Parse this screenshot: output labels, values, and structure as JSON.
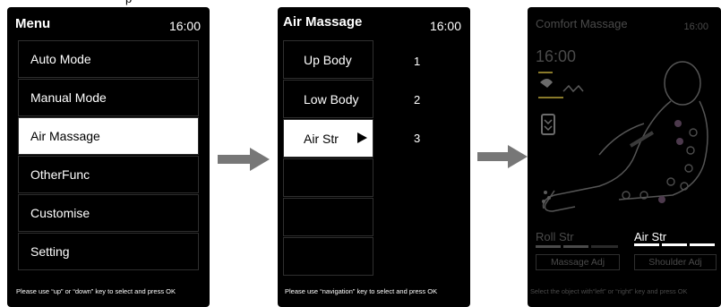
{
  "top_partial_text": "p",
  "screen1": {
    "title": "Menu",
    "time": "16:00",
    "items": [
      "Auto Mode",
      "Manual Mode",
      "Air Massage",
      "OtherFunc",
      "Customise",
      "Setting"
    ],
    "selected_index": 2,
    "footer": "Please use “up” or “down” key to select and press OK"
  },
  "screen2": {
    "title": "Air Massage",
    "time": "16:00",
    "items": [
      "Up Body",
      "Low Body",
      "Air Str",
      "",
      "",
      ""
    ],
    "numbers": [
      "1",
      "2",
      "3"
    ],
    "selected_index": 2,
    "footer": "Please use “navigation” key to select and press OK"
  },
  "screen3": {
    "title": "Comfort Massage",
    "time_corner": "16:00",
    "time_big": "16:00",
    "roll_label": "Roll Str",
    "air_label": "Air Str",
    "massage_adj": "Massage Adj",
    "shoulder_adj": "Shoulder Adj",
    "footer": "Select the object with“left” or “right” key and press OK"
  },
  "colors": {
    "screen_bg": "#000000",
    "arrow": "#777777",
    "highlight": "#ffffff",
    "dim_text": "#4a4a4a",
    "accent_yellow": "#8a7a2a"
  }
}
